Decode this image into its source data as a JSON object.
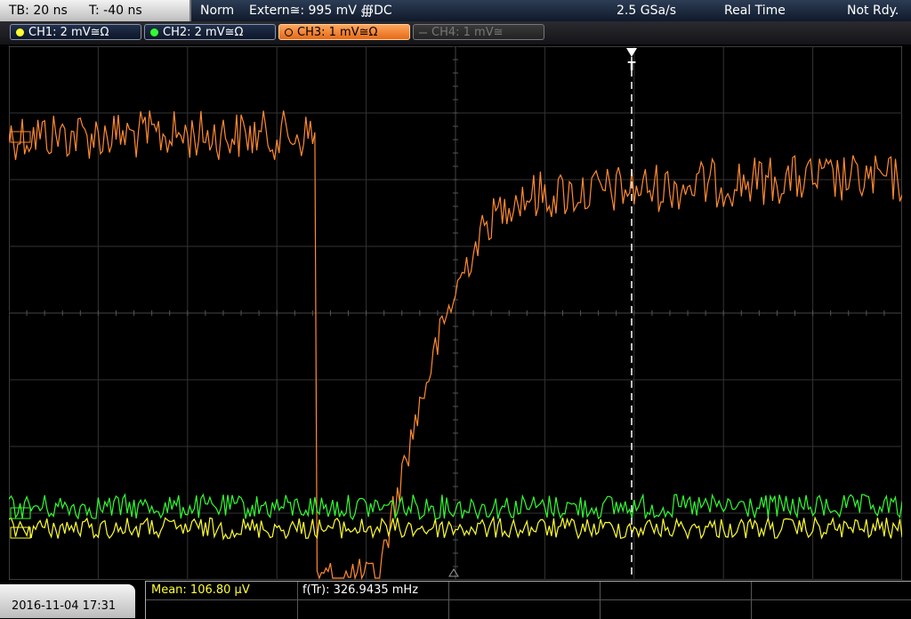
{
  "header": {
    "timebase": "TB: 20 ns",
    "trigger_time": "T: -40 ns",
    "trigger_mode": "Norm",
    "trigger_source": "Extern≅: 995 mV ∰DC",
    "sample_rate": "2.5 GSa/s",
    "acq_mode": "Real Time",
    "status": "Not Rdy."
  },
  "channels": [
    {
      "label": "CH1: 2 mV≅Ω",
      "color": "#ffff30",
      "state": "on"
    },
    {
      "label": "CH2: 2 mV≅Ω",
      "color": "#30ff30",
      "state": "on"
    },
    {
      "label": "CH3: 1 mV≅Ω",
      "color": "#ff8a30",
      "state": "active"
    },
    {
      "label": "CH4: 1 mV≅",
      "color": "#777777",
      "state": "off"
    }
  ],
  "trigger_marker": "T",
  "footer": {
    "datetime": "2016-11-04 17:31",
    "measurements": [
      {
        "label": "Mean: 106.80 µV",
        "color": "#ffff30"
      },
      {
        "label": "f(Tr): 326.9435 mHz",
        "color": "#ffffff"
      }
    ]
  }
}
